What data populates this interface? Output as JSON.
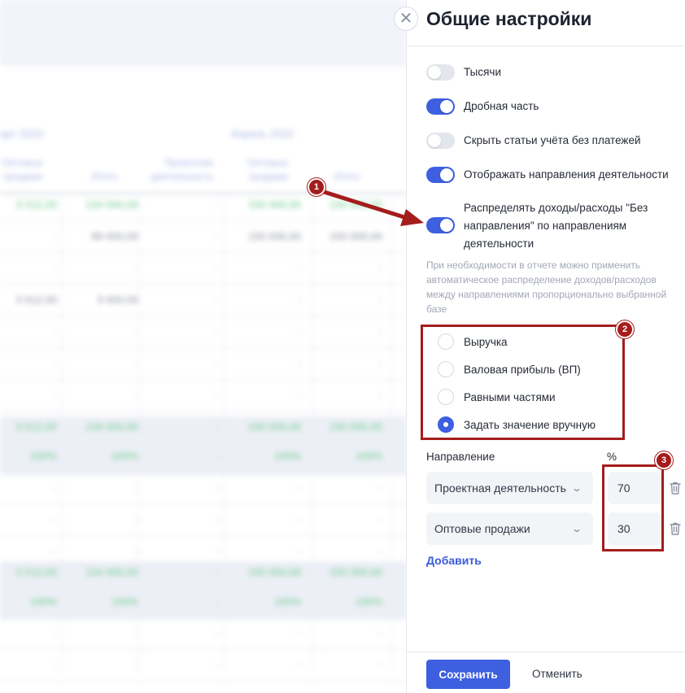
{
  "background": {
    "months": [
      "арт 2023",
      "Апрель 2023"
    ],
    "columns": [
      [
        "Оптовые",
        "продажи"
      ],
      [
        "Итого"
      ],
      [
        "Проектная",
        "деятельность"
      ],
      [
        "Оптовые",
        "продажи"
      ],
      [
        "Итого"
      ]
    ],
    "rows": [
      [
        "3 012,00",
        "134 000,00",
        "-",
        "150 000,00",
        "150 000,00"
      ],
      [
        "-",
        "99 000,00",
        "-",
        "150 000,00",
        "150 000,00"
      ],
      [
        "-",
        "-",
        "-",
        "-",
        "-"
      ],
      [
        "3 012,00",
        "3 000,00",
        "-",
        "-",
        "-"
      ],
      [
        "-",
        "-",
        "-",
        "-",
        "-"
      ],
      [
        "-",
        "-",
        "-",
        "-",
        "-"
      ],
      [
        "-",
        "-",
        "-",
        "-",
        "-"
      ],
      [
        "3 012,00",
        "134 000,00",
        "-",
        "150 000,00",
        "150 000,00"
      ],
      [
        "100%",
        "100%",
        "-",
        "100%",
        "100%"
      ],
      [
        "-",
        "-",
        "-",
        "-",
        "-"
      ],
      [
        "-",
        "-",
        "-",
        "-",
        "-"
      ],
      [
        "-",
        "-",
        "-",
        "-",
        "-"
      ],
      [
        "3 012,00",
        "134 000,00",
        "-",
        "150 000,00",
        "150 000,00"
      ],
      [
        "100%",
        "100%",
        "-",
        "100%",
        "100%"
      ],
      [
        "-",
        "-",
        "-",
        "-",
        "-"
      ],
      [
        "-",
        "-",
        "-",
        "-",
        "-"
      ]
    ]
  },
  "panel": {
    "title": "Общие настройки",
    "close_glyph": "✕",
    "toggles": [
      {
        "label": "Тысячи",
        "on": false
      },
      {
        "label": "Дробная часть",
        "on": true
      },
      {
        "label": "Скрыть статьи учёта без платежей",
        "on": false
      },
      {
        "label": "Отображать направления деятельности",
        "on": true
      },
      {
        "label": "Распределять доходы/расходы \"Без направления\" по направлениям деятельности",
        "on": true
      }
    ],
    "hint": "При необходимости в отчете можно применить автоматическое распределение доходов/расходов между направлениями пропорционально выбранной базе",
    "radios": [
      {
        "label": "Выручка",
        "checked": false
      },
      {
        "label": "Валовая прибыль (ВП)",
        "checked": false
      },
      {
        "label": "Равными частями",
        "checked": false
      },
      {
        "label": "Задать значение вручную",
        "checked": true
      }
    ],
    "direction_header": "Направление",
    "percent_header": "%",
    "allocations": [
      {
        "direction": "Проектная деятельность",
        "percent": "70"
      },
      {
        "direction": "Оптовые продажи",
        "percent": "30"
      }
    ],
    "add_label": "Добавить",
    "save_label": "Сохранить",
    "cancel_label": "Отменить"
  },
  "annotations": {
    "badges": [
      "1",
      "2",
      "3"
    ],
    "color": "#a51c1c"
  },
  "colors": {
    "accent": "#3d5fe0",
    "positive": "#6cc98a"
  }
}
